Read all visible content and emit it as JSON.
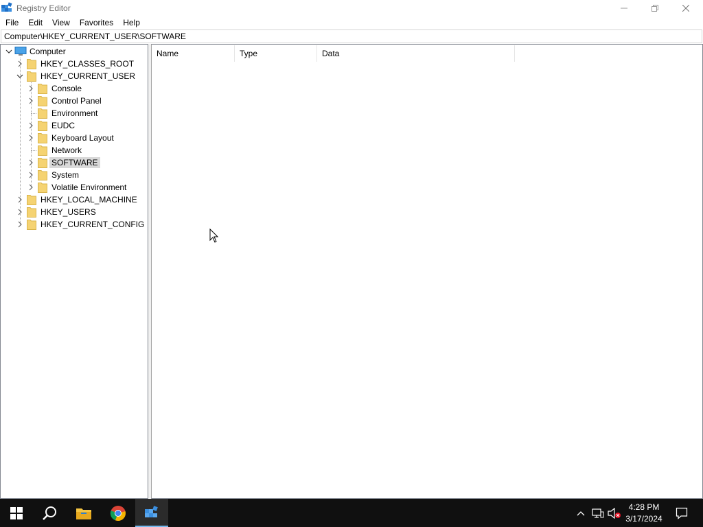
{
  "window": {
    "title": "Registry Editor",
    "minimize_icon": "minimize-icon",
    "restore_icon": "restore-icon",
    "close_icon": "close-icon"
  },
  "menu": [
    "File",
    "Edit",
    "View",
    "Favorites",
    "Help"
  ],
  "address": "Computer\\HKEY_CURRENT_USER\\SOFTWARE",
  "tree": {
    "root": "Computer",
    "hives": [
      "HKEY_CLASSES_ROOT",
      "HKEY_CURRENT_USER",
      "HKEY_LOCAL_MACHINE",
      "HKEY_USERS",
      "HKEY_CURRENT_CONFIG"
    ],
    "current_user_children": [
      "Console",
      "Control Panel",
      "Environment",
      "EUDC",
      "Keyboard Layout",
      "Network",
      "SOFTWARE",
      "System",
      "Volatile Environment"
    ],
    "selected": "SOFTWARE"
  },
  "list": {
    "columns": [
      "Name",
      "Type",
      "Data"
    ]
  },
  "taskbar": {
    "apps": [
      "start-icon",
      "search-icon",
      "file-explorer-icon",
      "chrome-icon",
      "registry-editor-icon"
    ],
    "time": "4:28 PM",
    "date": "3/17/2024"
  },
  "colors": {
    "taskbar": "#101010",
    "selection": "#d9d9d9",
    "folder": "#f5d372",
    "accent": "#76b9ed"
  }
}
